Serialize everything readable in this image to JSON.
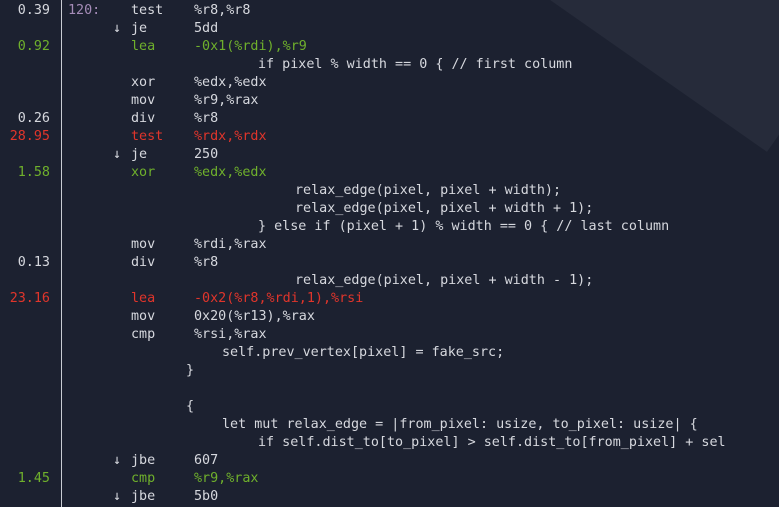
{
  "colors": {
    "background": "#1c2130",
    "text": "#d6d8de",
    "hot": "#e0352b",
    "warm": "#6fb02c",
    "label": "#a58cb8",
    "separator": "#c9ccd3"
  },
  "rows": [
    {
      "pct": "0.39",
      "heat": "cold",
      "label": "120:",
      "mnem": "test",
      "ops": "%r8,%r8"
    },
    {
      "arrow": "↓",
      "mnem": "je",
      "ops": "5dd",
      "heat": "cold"
    },
    {
      "pct": "0.92",
      "heat": "warm",
      "mnem": "lea",
      "ops": "-0x1(%rdi),%r9"
    },
    {
      "src": "if pixel % width == 0 { // first column",
      "indent": 258
    },
    {
      "mnem": "xor",
      "ops": "%edx,%edx",
      "heat": "cold"
    },
    {
      "mnem": "mov",
      "ops": "%r9,%rax",
      "heat": "cold"
    },
    {
      "pct": "0.26",
      "heat": "cold",
      "mnem": "div",
      "ops": "%r8"
    },
    {
      "pct": "28.95",
      "heat": "hot",
      "mnem": "test",
      "ops": "%rdx,%rdx"
    },
    {
      "arrow": "↓",
      "mnem": "je",
      "ops": "250",
      "heat": "cold"
    },
    {
      "pct": "1.58",
      "heat": "warm",
      "mnem": "xor",
      "ops": "%edx,%edx"
    },
    {
      "src": "relax_edge(pixel, pixel + width);",
      "indent": 295
    },
    {
      "src": "relax_edge(pixel, pixel + width + 1);",
      "indent": 295
    },
    {
      "src": "} else if (pixel + 1) % width == 0 { // last column",
      "indent": 258
    },
    {
      "mnem": "mov",
      "ops": "%rdi,%rax",
      "heat": "cold"
    },
    {
      "pct": "0.13",
      "heat": "cold",
      "mnem": "div",
      "ops": "%r8"
    },
    {
      "src": "relax_edge(pixel, pixel + width - 1);",
      "indent": 295
    },
    {
      "pct": "23.16",
      "heat": "hot",
      "mnem": "lea",
      "ops": "-0x2(%r8,%rdi,1),%rsi"
    },
    {
      "mnem": "mov",
      "ops": "0x20(%r13),%rax",
      "heat": "cold"
    },
    {
      "mnem": "cmp",
      "ops": "%rsi,%rax",
      "heat": "cold"
    },
    {
      "src": "self.prev_vertex[pixel] = fake_src;",
      "indent": 222
    },
    {
      "src": "}",
      "indent": 186
    },
    {
      "src": "",
      "indent": 186
    },
    {
      "src": "{",
      "indent": 186
    },
    {
      "src": "let mut relax_edge = |from_pixel: usize, to_pixel: usize| {",
      "indent": 222
    },
    {
      "src": "if self.dist_to[to_pixel] > self.dist_to[from_pixel] + sel",
      "indent": 258
    },
    {
      "arrow": "↓",
      "mnem": "jbe",
      "ops": "607",
      "heat": "cold"
    },
    {
      "pct": "1.45",
      "heat": "warm",
      "mnem": "cmp",
      "ops": "%r9,%rax"
    },
    {
      "arrow": "↓",
      "mnem": "jbe",
      "ops": "5b0",
      "heat": "cold"
    }
  ]
}
